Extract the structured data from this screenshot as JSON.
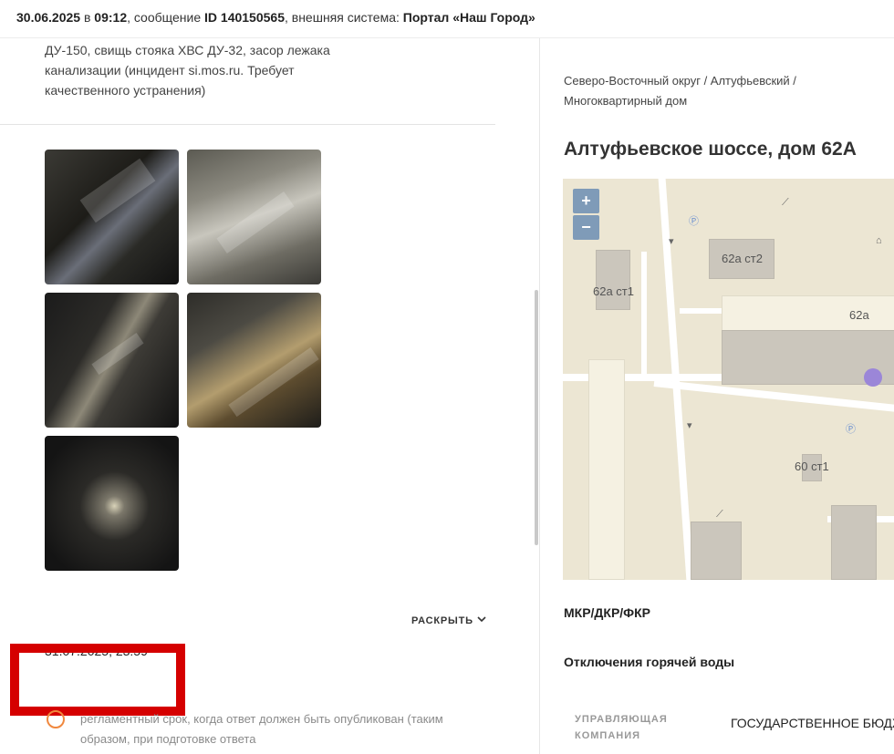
{
  "header": {
    "date": "30.06.2025",
    "in_word": "в",
    "time": "09:12",
    "message_word": ", сообщение",
    "id_label": "ID 140150565",
    "external_word": ", внешняя система:",
    "portal": "Портал «Наш Город»"
  },
  "left": {
    "description": "ДУ-150, свищь стояка ХВС ДУ-32, засор лежака канализации (инцидент si.mos.ru. Требует качественного устранения)",
    "expand_label": "РАСКРЫТЬ",
    "deadline": "31.07.2025, 23:59",
    "deadline_note": "регламентный срок, когда ответ должен быть опубликован (таким образом, при подготовке ответа"
  },
  "right": {
    "breadcrumb": "Северо-Восточный округ / Алтуфьевский / Многоквартирный дом",
    "address": "Алтуфьевское шоссе, дом 62А",
    "map": {
      "zoom_in": "+",
      "zoom_out": "−",
      "labels": {
        "b1": "62а ст1",
        "b2": "62а ст2",
        "b3": "62а",
        "b4": "60 ст1"
      }
    },
    "section1": "МКР/ДКР/ФКР",
    "section2": "Отключения горячей воды",
    "mgmt_key": "УПРАВЛЯЮЩАЯ КОМПАНИЯ",
    "mgmt_value": "ГОСУДАРСТВЕННОЕ БЮДЖЕТНОЕ «ЖИЛИЩНИК АЛТУФЬЕВСКОГО»"
  },
  "colors": {
    "highlight_box": "#d50000",
    "map_zoom_buttons": "#7f9bb8",
    "map_marker": "#9b86d8",
    "status_dot": "#f0883e"
  }
}
